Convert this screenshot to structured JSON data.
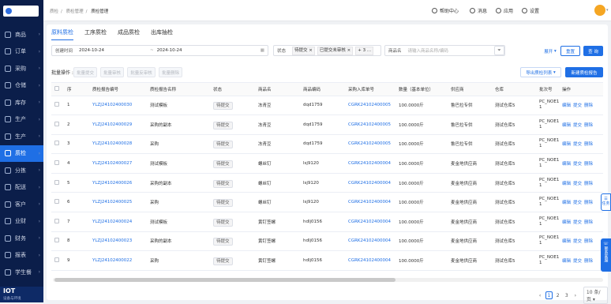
{
  "sidebar": {
    "items": [
      {
        "label": "商品",
        "active": false
      },
      {
        "label": "订单",
        "active": false
      },
      {
        "label": "采购",
        "active": false
      },
      {
        "label": "仓储",
        "active": false
      },
      {
        "label": "库存",
        "active": false
      },
      {
        "label": "生产",
        "active": false
      },
      {
        "label": "生产",
        "active": false
      },
      {
        "label": "质检",
        "active": true
      },
      {
        "label": "分拣",
        "active": false
      },
      {
        "label": "配送",
        "active": false
      },
      {
        "label": "客户",
        "active": false
      },
      {
        "label": "业财",
        "active": false
      },
      {
        "label": "财务",
        "active": false
      },
      {
        "label": "报表",
        "active": false
      },
      {
        "label": "学生餐",
        "active": false
      }
    ],
    "footer_title": "IOT",
    "footer_sub": "设备与环境"
  },
  "topbar": {
    "breadcrumb": [
      "质检",
      "质检管理",
      "质检管理"
    ],
    "help": "帮助中心",
    "message": "消息",
    "apps": "应用",
    "settings": "设置"
  },
  "tabs": [
    "原料质检",
    "工序质检",
    "成品质检",
    "出库抽检"
  ],
  "filters": {
    "date_label": "创建时间",
    "date_start": "2024-10-24",
    "date_sep": "~",
    "date_end": "2024-10-24",
    "status_label": "状态",
    "status_tags": [
      "待提交",
      "已提交未审核"
    ],
    "status_more": "+ 3 ...",
    "product_label": "商品名",
    "product_placeholder": "请输入商品名称/编码",
    "expand": "展开",
    "reset": "重置",
    "search": "查 询"
  },
  "actions": {
    "batch_label": "批量操作 :",
    "batch_submit": "批量提交",
    "batch_approve": "批量审核",
    "batch_reverse": "批量反审核",
    "batch_delete": "批量删除",
    "export": "导出质检列表",
    "create": "新建质检报告"
  },
  "table": {
    "columns": [
      "",
      "序",
      "质检报告编号",
      "质检报告名称",
      "状态",
      "商品名",
      "商品编码",
      "采购入库单号",
      "数量（基本单位）",
      "供应商",
      "仓库",
      "批次号",
      "操作"
    ],
    "rows": [
      {
        "idx": "1",
        "code": "YLZJ24102400030",
        "name": "测试模板",
        "status": "待提交",
        "product": "冻青豆",
        "pcode": "dqd1759",
        "order": "CGRK24102400005",
        "qty": "100.0000斤",
        "supplier": "鲁巴拉专供",
        "warehouse": "测试仓库5",
        "batch": "PC_NOE1"
      },
      {
        "idx": "2",
        "code": "YLZJ24102400029",
        "name": "采购的副本",
        "status": "待提交",
        "product": "冻青豆",
        "pcode": "dqd1759",
        "order": "CGRK24102400005",
        "qty": "100.0000斤",
        "supplier": "鲁巴拉专供",
        "warehouse": "测试仓库5",
        "batch": "PC_NOE1"
      },
      {
        "idx": "3",
        "code": "YLZJ24102400028",
        "name": "采购",
        "status": "待提交",
        "product": "冻青豆",
        "pcode": "dqd1759",
        "order": "CGRK24102400005",
        "qty": "100.0000斤",
        "supplier": "鲁巴拉专供",
        "warehouse": "测试仓库5",
        "batch": "PC_NOE1"
      },
      {
        "idx": "4",
        "code": "YLZJ24102400027",
        "name": "测试模板",
        "status": "待提交",
        "product": "螺丝钉",
        "pcode": "lsj9120",
        "order": "CGRK24102400004",
        "qty": "100.0000斤",
        "supplier": "麦金地供应商",
        "warehouse": "测试仓库5",
        "batch": "PC_NOE1"
      },
      {
        "idx": "5",
        "code": "YLZJ24102400026",
        "name": "采购的副本",
        "status": "待提交",
        "product": "螺丝钉",
        "pcode": "lsj9120",
        "order": "CGRK24102400004",
        "qty": "100.0000斤",
        "supplier": "麦金地供应商",
        "warehouse": "测试仓库5",
        "batch": "PC_NOE1"
      },
      {
        "idx": "6",
        "code": "YLZJ24102400025",
        "name": "采购",
        "status": "待提交",
        "product": "螺丝钉",
        "pcode": "lsj9120",
        "order": "CGRK24102400004",
        "qty": "100.0000斤",
        "supplier": "麦金地供应商",
        "warehouse": "测试仓库5",
        "batch": "PC_NOE1"
      },
      {
        "idx": "7",
        "code": "YLZJ24102400024",
        "name": "测试模板",
        "status": "待提交",
        "product": "黄钉签螺",
        "pcode": "hdlj0156",
        "order": "CGRK24102400004",
        "qty": "100.0000斤",
        "supplier": "麦金地供应商",
        "warehouse": "测试仓库5",
        "batch": "PC_NOE1"
      },
      {
        "idx": "8",
        "code": "YLZJ24102400023",
        "name": "采购的副本",
        "status": "待提交",
        "product": "黄钉签螺",
        "pcode": "hdlj0156",
        "order": "CGRK24102400004",
        "qty": "100.0000斤",
        "supplier": "麦金地供应商",
        "warehouse": "测试仓库5",
        "batch": "PC_NOE1"
      },
      {
        "idx": "9",
        "code": "YLZJ24102400022",
        "name": "采购",
        "status": "待提交",
        "product": "黄钉签螺",
        "pcode": "hdlj0156",
        "order": "CGRK24102400004",
        "qty": "100.0000斤",
        "supplier": "麦金地供应商",
        "warehouse": "测试仓库5",
        "batch": "PC_NOE1"
      }
    ],
    "ops": [
      "编辑",
      "提交",
      "删除"
    ]
  },
  "pagination": {
    "pages": [
      "1",
      "2",
      "3"
    ],
    "current": "1",
    "page_size": "10 条/页"
  },
  "float": {
    "task": "任务",
    "service": "联系客服"
  },
  "colors": {
    "primary": "#1f6fe5",
    "sidebar": "#0b1e4a"
  }
}
